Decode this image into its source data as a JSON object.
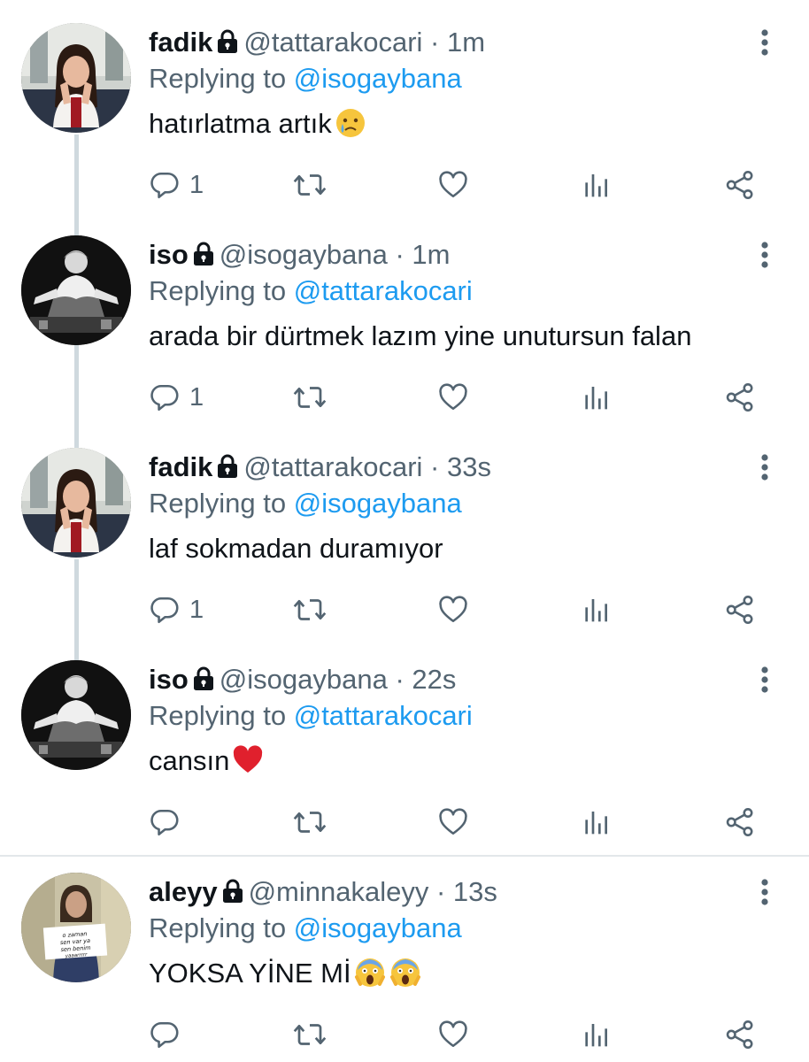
{
  "tweets": [
    {
      "name": "fadik",
      "handle": "@tattarakocari",
      "time": "· 1m",
      "replying_prefix": "Replying to",
      "replying_to": "@isogaybana",
      "text": "hatırlatma artık",
      "emoji": "😢",
      "reply_count": "1",
      "avatar": "girl-with-hands-on-cheeks"
    },
    {
      "name": "iso",
      "handle": "@isogaybana",
      "time": "· 1m",
      "replying_prefix": "Replying to",
      "replying_to": "@tattarakocari",
      "text": "arada bir dürtmek lazım yine unutursun falan",
      "emoji": "",
      "reply_count": "1",
      "avatar": "seated-man-black-white"
    },
    {
      "name": "fadik",
      "handle": "@tattarakocari",
      "time": "· 33s",
      "replying_prefix": "Replying to",
      "replying_to": "@isogaybana",
      "text": "laf sokmadan duramıyor",
      "emoji": "",
      "reply_count": "1",
      "avatar": "girl-with-hands-on-cheeks"
    },
    {
      "name": "iso",
      "handle": "@isogaybana",
      "time": "· 22s",
      "replying_prefix": "Replying to",
      "replying_to": "@tattarakocari",
      "text": "cansın",
      "emoji": "❤️",
      "reply_count": "",
      "avatar": "seated-man-black-white"
    },
    {
      "name": "aleyy",
      "handle": "@minnakaleyy",
      "time": "· 13s",
      "replying_prefix": "Replying to",
      "replying_to": "@isogaybana",
      "text": "YOKSA YİNE Mİ",
      "emoji": "😱😱",
      "reply_count": "",
      "avatar": "girl-holding-sign",
      "avatar_sign_text": "o zaman sen var ya sen benim yaaarrrrr"
    }
  ],
  "colors": {
    "accent": "#1d9bf0",
    "secondary_text": "#536471",
    "primary_text": "#0f1419",
    "thread_line": "#cfd9de"
  },
  "icons": [
    "lock-icon",
    "more-icon",
    "reply-icon",
    "retweet-icon",
    "like-icon",
    "views-icon",
    "share-icon"
  ]
}
